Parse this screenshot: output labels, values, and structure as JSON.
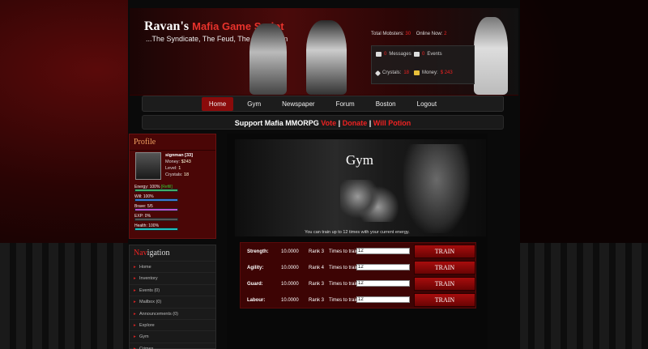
{
  "header": {
    "logo_main": "Ravan's ",
    "logo_accent": "Mafia Game Script",
    "tagline": "...The Syndicate, The Feud, The Coronation",
    "total_mobsters_label": "Total Mobsters:",
    "total_mobsters_value": "30",
    "online_now_label": "Online Now:",
    "online_now_value": "2",
    "messages_value": "0",
    "messages_label": "Messages",
    "events_value": "0",
    "events_label": "Events",
    "crystals_label": "Crystals:",
    "crystals_value": "18",
    "money_label": "Money:",
    "money_value": "$ 243"
  },
  "nav": [
    "Home",
    "Gym",
    "Newspaper",
    "Forum",
    "Boston",
    "Logout"
  ],
  "support": {
    "text": "Support Mafia MMORPG",
    "vote": "Vote",
    "sep": "|",
    "donate": "Donate",
    "will_potion": "Will Potion"
  },
  "profile": {
    "title": "Profile",
    "name": "signman [33]",
    "money_label": "Money:",
    "money": "$243",
    "level_label": "Level:",
    "level": "1",
    "crystals_label": "Crystals:",
    "crystals": "18",
    "energy_label": "Energy:",
    "energy_value": "100%",
    "energy_extra": "[Refill]",
    "will_label": "Will:",
    "will_value": "100%",
    "brave_label": "Brave:",
    "brave_value": "5/5",
    "exp_label": "EXP:",
    "exp_value": "0%",
    "health_label": "Health:",
    "health_value": "100%"
  },
  "navigation": {
    "title_red": "Nav",
    "title_rest": "igation",
    "items": [
      "Home",
      "Inventory",
      "Events (0)",
      "Mailbox (0)",
      "Announcements (0)",
      "Explore",
      "Gym",
      "Crimes"
    ]
  },
  "gym": {
    "title": "Gym",
    "train_msg": "You can train up to 12 times with your current energy.",
    "rows": [
      {
        "stat": "Strength:",
        "value": "10.0000",
        "rank": "Rank 3",
        "times_label": "Times to train:",
        "input": "12",
        "button": "TRAIN"
      },
      {
        "stat": "Agility:",
        "value": "10.0000",
        "rank": "Rank 4",
        "times_label": "Times to train:",
        "input": "12",
        "button": "TRAIN"
      },
      {
        "stat": "Guard:",
        "value": "10.0000",
        "rank": "Rank 3",
        "times_label": "Times to train:",
        "input": "12",
        "button": "TRAIN"
      },
      {
        "stat": "Labour:",
        "value": "10.0000",
        "rank": "Rank 3",
        "times_label": "Times to train:",
        "input": "12",
        "button": "TRAIN"
      }
    ]
  },
  "colors": {
    "accent": "#e22222",
    "panel": "#4a0606",
    "button": "#a80d0d"
  },
  "bar_levels": {
    "energy": 1.0,
    "will": 1.0,
    "brave": 1.0,
    "exp": 0.0,
    "health": 1.0
  }
}
